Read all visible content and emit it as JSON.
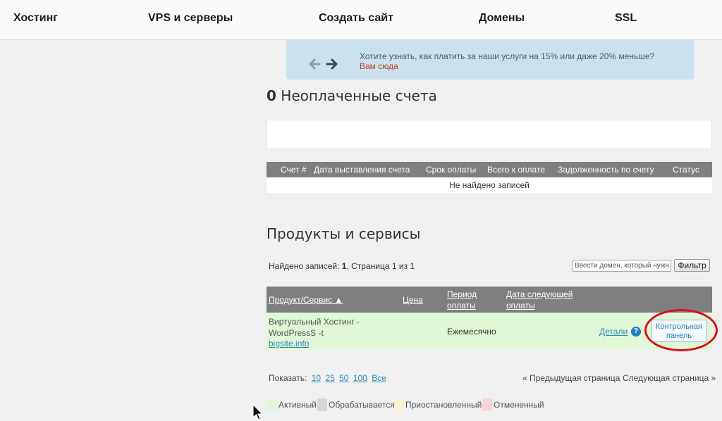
{
  "nav": {
    "items": [
      "Хостинг",
      "VPS и серверы",
      "Создать сайт",
      "Домены",
      "SSL"
    ]
  },
  "promo": {
    "text": "Хотите узнать, как платить за наши услуги на 15% или даже 20% меньше?",
    "link": "Вам сюда",
    "icons": [
      "arrow-left-icon",
      "arrow-right-icon"
    ]
  },
  "unpaid": {
    "count": "0",
    "title": "Неоплаченные счета",
    "columns": [
      "Счет #",
      "Дата выставления счета",
      "Срок оплаты",
      "Всего к оплате",
      "Задолженность по счету",
      "Статус"
    ],
    "empty_text": "Не найдено записей"
  },
  "products": {
    "title": "Продукты и сервисы",
    "found_prefix": "Найдено записей: ",
    "found_count": "1",
    "found_suffix": ", Страница 1 из 1",
    "filter_placeholder": "Ввести домен, который нужно найти",
    "filter_button": "Фильтр",
    "columns": {
      "product": "Продукт/Сервис ▲",
      "price": "Цена",
      "period_l1": "Период",
      "period_l2": "оплаты",
      "next_l1": "Дата следующей",
      "next_l2": "оплаты"
    },
    "row": {
      "name_l1": "Виртуальный Хостинг -",
      "name_l2": "WordPressS -t",
      "domain": "bigsite.info",
      "price": "",
      "period": "Ежемесячно",
      "next_date": "",
      "details": "Детали",
      "help": "?",
      "cp_l1": "Контрольная",
      "cp_l2": "панель",
      "status_color": "#dff7d6"
    }
  },
  "pagination": {
    "show_label": "Показать:",
    "sizes": [
      "10",
      "25",
      "50",
      "100",
      "Все"
    ],
    "prev": "« Предыдущая страница",
    "next": "Следующая страница »"
  },
  "legend": [
    {
      "label": "Активный",
      "color": "#dff7d6"
    },
    {
      "label": "Обрабатывается",
      "color": "#d6d6d6"
    },
    {
      "label": "Приостановленный",
      "color": "#f8f1d0"
    },
    {
      "label": "Отмененный",
      "color": "#f6d6d6"
    }
  ],
  "colors": {
    "header_gray": "#7f7f7f",
    "link_blue": "#2a8ab8",
    "promo_bg": "#c9e2ee",
    "highlight_red": "#d8111b"
  }
}
